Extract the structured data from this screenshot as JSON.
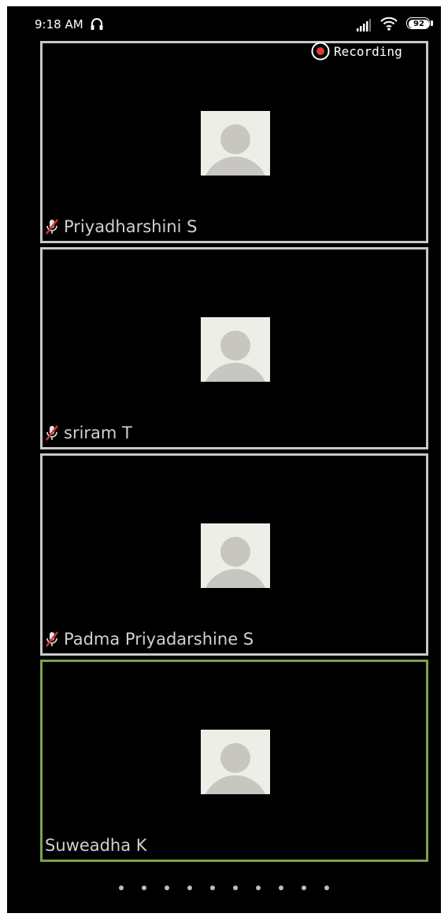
{
  "status_bar": {
    "time": "9:18 AM",
    "battery": "92",
    "icons": [
      "headphone-icon",
      "signal-icon",
      "wifi-icon",
      "battery-icon"
    ]
  },
  "recording": {
    "label": "Recording",
    "icon": "record-icon",
    "color": "#e53935"
  },
  "participants": [
    {
      "name": "Priyadharshini S",
      "muted": true,
      "active": false
    },
    {
      "name": "sriram T",
      "muted": true,
      "active": false
    },
    {
      "name": "Padma Priyadarshine S",
      "muted": true,
      "active": false
    },
    {
      "name": "Suweadha K",
      "muted": false,
      "active": true
    }
  ],
  "pagination": {
    "page_count": 10
  },
  "colors": {
    "background": "#000000",
    "tile_border": "#c8c8c8",
    "active_speaker_border": "#7ca24a",
    "muted_icon": "#d32f2f"
  }
}
